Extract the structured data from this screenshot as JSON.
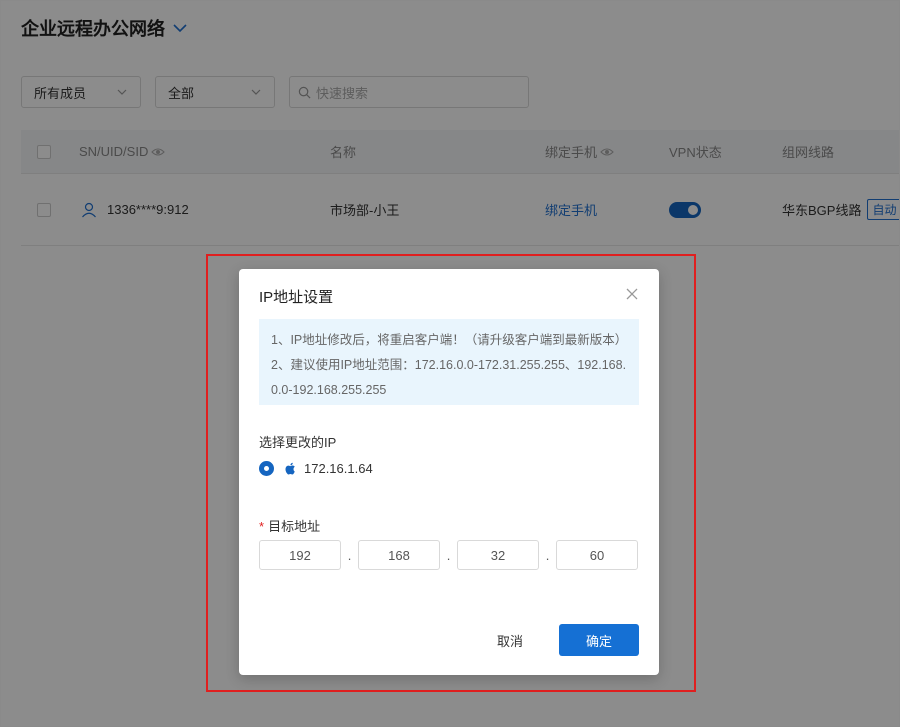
{
  "header": {
    "title": "企业远程办公网络"
  },
  "filters": {
    "member_select": "所有成员",
    "status_select": "全部",
    "search_placeholder": "快速搜索"
  },
  "table": {
    "columns": [
      "SN/UID/SID",
      "名称",
      "绑定手机",
      "VPN状态",
      "组网线路"
    ],
    "rows": [
      {
        "id": "1336****9:912",
        "name": "市场部-小王",
        "phone": "绑定手机",
        "vpn_enabled": true,
        "route": "华东BGP线路",
        "route_tag": "自动"
      }
    ]
  },
  "modal": {
    "title": "IP地址设置",
    "notice_line1": "1、IP地址修改后，将重启客户端！（请升级客户端到最新版本）",
    "notice_line2": "2、建议使用IP地址范围：172.16.0.0-172.31.255.255、192.168.",
    "notice_line3": "0.0-192.168.255.255",
    "select_ip_label": "选择更改的IP",
    "current_ip": "172.16.1.64",
    "target_label": "目标地址",
    "target_ip": [
      "192",
      "168",
      "32",
      "60"
    ],
    "separator": ".",
    "cancel_label": "取消",
    "confirm_label": "确定"
  },
  "colors": {
    "accent": "#1570d4",
    "highlight_border": "#e01f1f",
    "notice_bg": "#e9f5fd"
  }
}
